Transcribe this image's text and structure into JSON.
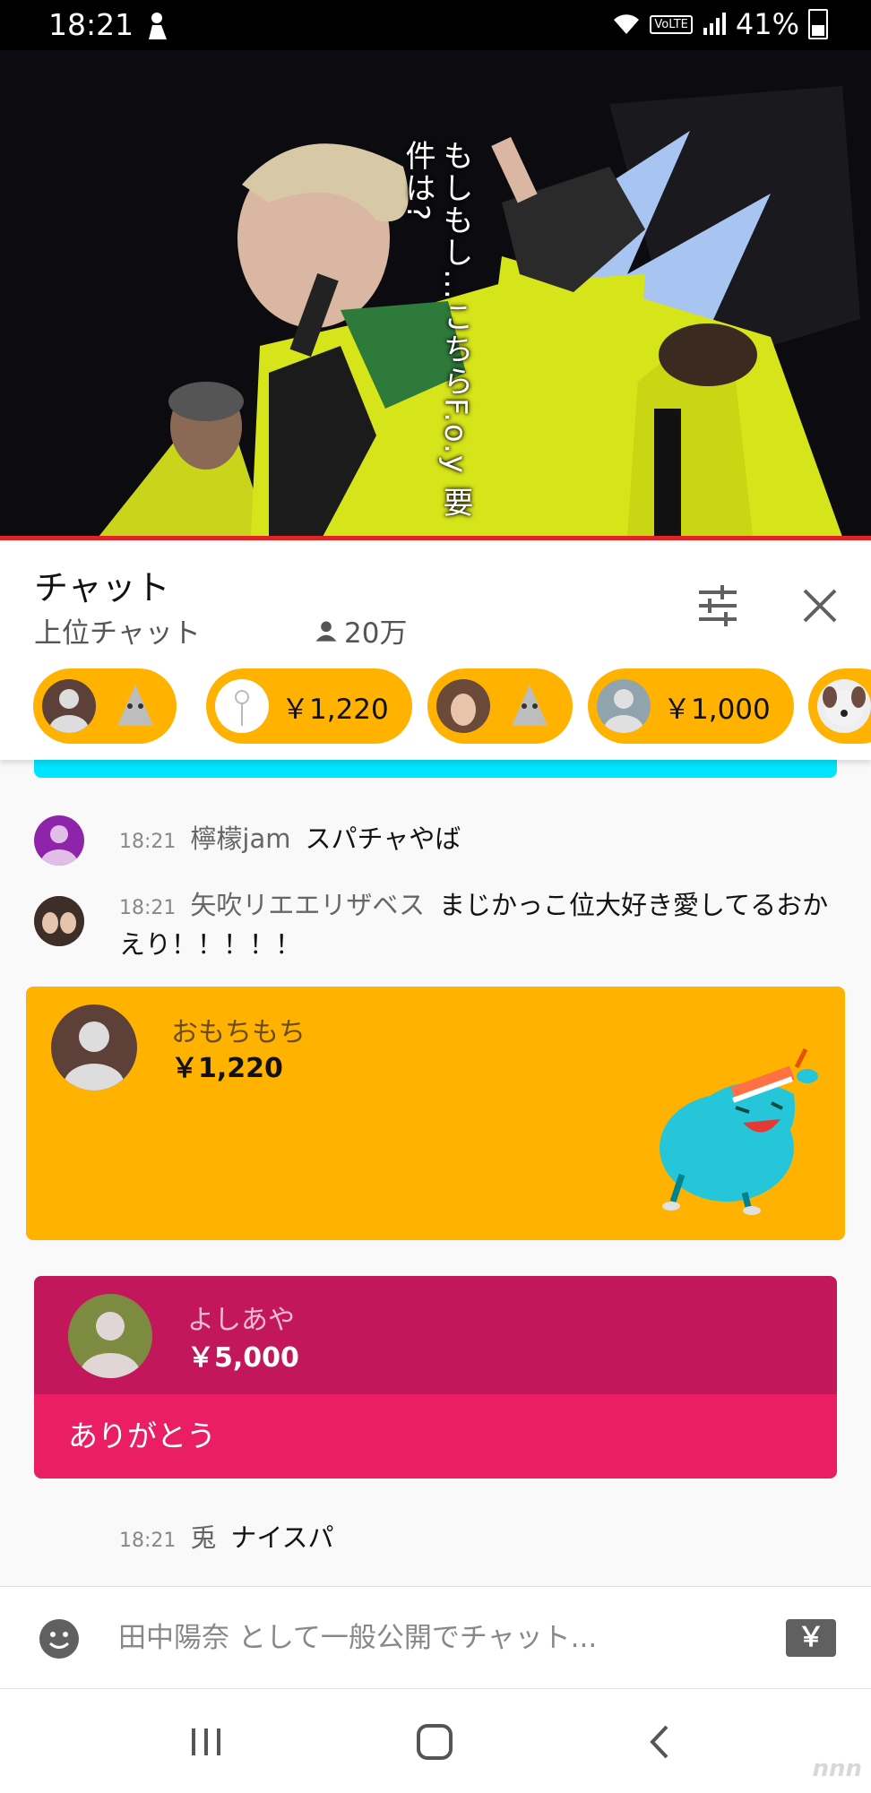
{
  "status_bar": {
    "time": "18:21",
    "network_badge": "VoLTE",
    "battery": "41%"
  },
  "video": {
    "caption": "もしもし…こちらF.o.y 要件は?"
  },
  "chat_header": {
    "title": "チャット",
    "mode": "上位チャット",
    "viewers": "20万",
    "ticker": [
      {
        "avatar": "brown-person-avatar",
        "amount": ""
      },
      {
        "avatar": "rose-avatar",
        "amount": "￥1,220"
      },
      {
        "avatar": "girl-photo-avatar",
        "amount": ""
      },
      {
        "avatar": "grey-person-avatar",
        "amount": "￥1,000"
      },
      {
        "avatar": "dog-photo-avatar",
        "amount": ""
      }
    ]
  },
  "messages": [
    {
      "time": "18:21",
      "author": "檸檬jam",
      "text": "スパチャやば"
    },
    {
      "time": "18:21",
      "author": "矢吹リエエリザベス",
      "text": "まじかっこ位大好き愛してるおかえり！！！！！"
    },
    {
      "time": "18:21",
      "author": "兎",
      "text": "ナイスパ"
    }
  ],
  "superchat_1": {
    "name": "おもちもち",
    "amount": "￥1,220",
    "color": "#ffb300"
  },
  "superchat_2": {
    "name": "よしあや",
    "amount": "￥5,000",
    "message": "ありがとう",
    "color_head": "#c2185b",
    "color_body": "#e91e63"
  },
  "input": {
    "placeholder": "田中陽奈 として一般公開でチャット...",
    "yen_label": "￥"
  },
  "watermark": "nnn"
}
